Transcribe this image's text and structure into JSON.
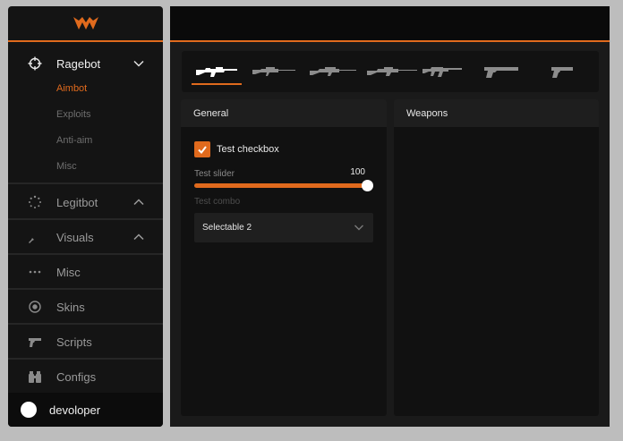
{
  "theme": {
    "accent": "#e06a1d",
    "sidebar_bg": "#141414",
    "panel_bg": "#111111"
  },
  "logo": {
    "icon": "wolf-logo-icon"
  },
  "nav": {
    "ragebot": {
      "label": "Ragebot",
      "icon": "crosshair-icon",
      "expanded": true,
      "sub_items": [
        "Aimbot",
        "Exploits",
        "Anti-aim",
        "Misc"
      ],
      "active_sub": "Aimbot"
    },
    "legitbot": {
      "label": "Legitbot",
      "icon": "spinner-icon",
      "expanded": false
    },
    "visuals": {
      "label": "Visuals",
      "icon": "knife-icon",
      "expanded": false
    },
    "misc": {
      "label": "Misc",
      "icon": "dots-icon"
    },
    "skins": {
      "label": "Skins",
      "icon": "target-icon"
    },
    "scripts": {
      "label": "Scripts",
      "icon": "pistol-icon"
    },
    "configs": {
      "label": "Configs",
      "icon": "binoculars-icon"
    }
  },
  "user": {
    "name": "devoloper"
  },
  "weapon_tabs": [
    {
      "icon": "auto-sniper-icon",
      "active": true
    },
    {
      "icon": "scout-rifle-icon",
      "active": false
    },
    {
      "icon": "awp-icon",
      "active": false
    },
    {
      "icon": "sniper-rifle-icon",
      "active": false
    },
    {
      "icon": "assault-rifle-icon",
      "active": false
    },
    {
      "icon": "heavy-pistol-icon",
      "active": false
    },
    {
      "icon": "pistol-icon",
      "active": false
    }
  ],
  "general": {
    "title": "General",
    "checkbox": {
      "label": "Test checkbox",
      "checked": true
    },
    "slider": {
      "label": "Test slider",
      "value": "100",
      "fraction": 1.0
    },
    "combo": {
      "label": "Test combo",
      "selected": "Selectable 2"
    }
  },
  "weapons": {
    "title": "Weapons"
  }
}
